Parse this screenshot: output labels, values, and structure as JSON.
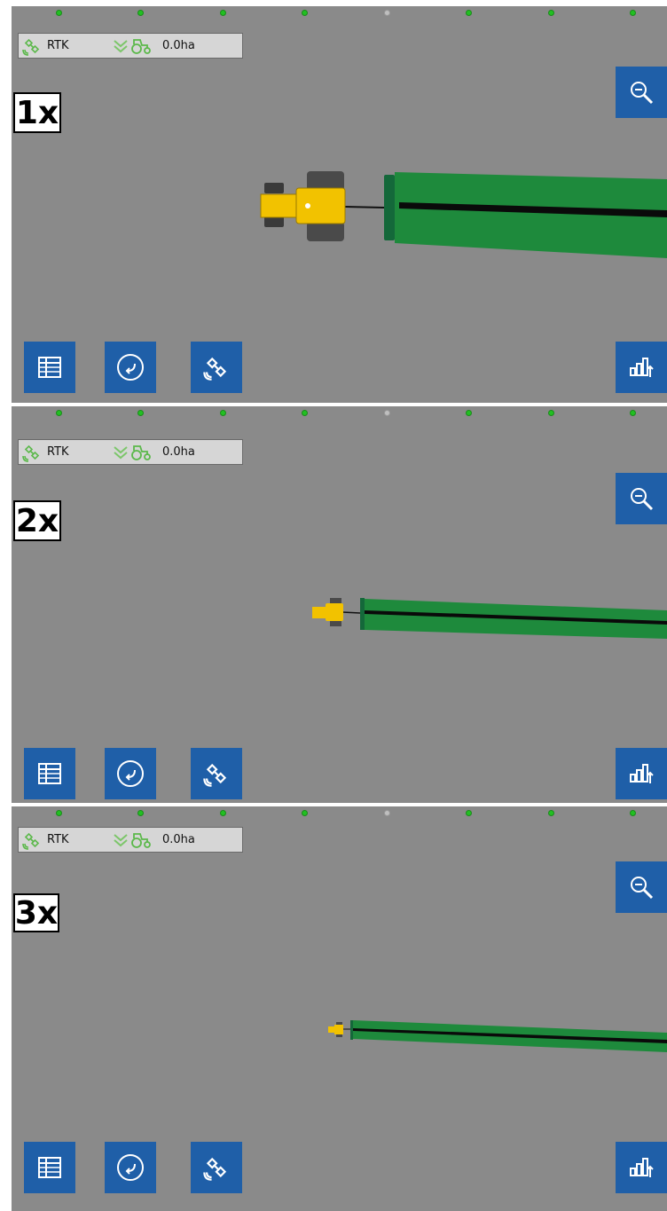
{
  "panels": [
    {
      "zoom_label": "1x"
    },
    {
      "zoom_label": "2x"
    },
    {
      "zoom_label": "3x"
    }
  ],
  "status_bar": {
    "gps_label": "RTK",
    "area_value": "0.0ha"
  },
  "indicator_dots": [
    "on",
    "on",
    "on",
    "on",
    "off",
    "on",
    "on",
    "on"
  ],
  "icons": {
    "status": [
      "satellite-icon",
      "double-chevron-icon",
      "tractor-icon"
    ],
    "right": [
      "zoom-out-icon",
      "bar-chart-icon"
    ],
    "bottom": [
      "table-icon",
      "rotate-icon",
      "satellite-icon"
    ]
  },
  "colors": {
    "map_background": "#8a8a8a",
    "button_blue": "#1f5fa8",
    "implement_green": "#1e8a3c",
    "tractor_yellow": "#f2c200",
    "indicator_green": "#22c022"
  }
}
